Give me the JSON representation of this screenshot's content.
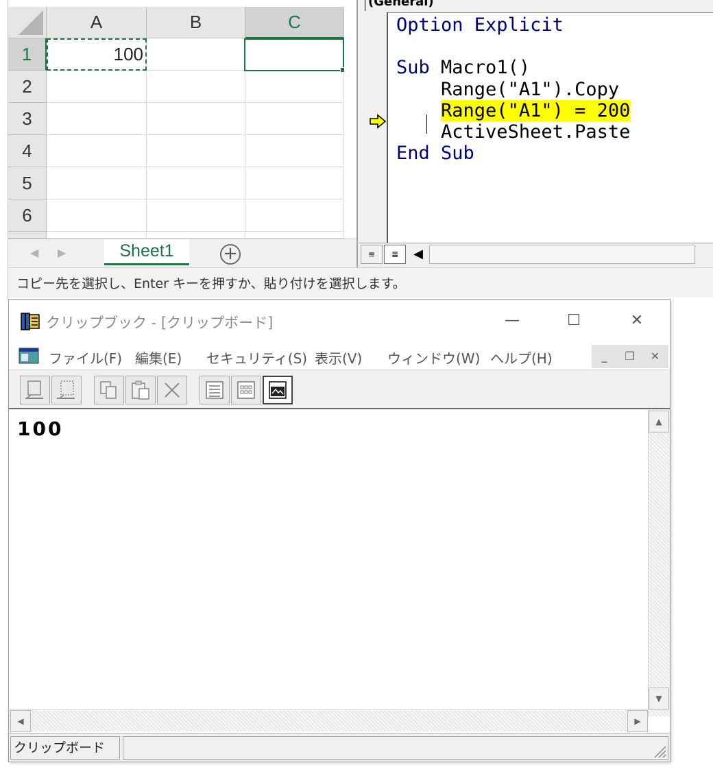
{
  "excel": {
    "columns": [
      "A",
      "B",
      "C"
    ],
    "rows": [
      "1",
      "2",
      "3",
      "4",
      "5",
      "6"
    ],
    "cells": {
      "A1": "100"
    },
    "selected_column": "C",
    "sheet_tab": "Sheet1",
    "add_sheet_symbol": "+",
    "status_message": "コピー先を選択し、Enter キーを押すか、貼り付けを選択します。"
  },
  "vba": {
    "combo_label": "(General)",
    "code": [
      {
        "indent": "",
        "parts": [
          {
            "t": "Option Explicit",
            "kw": true
          }
        ]
      },
      {
        "indent": "",
        "parts": []
      },
      {
        "indent": "",
        "parts": [
          {
            "t": "Sub",
            "kw": true
          },
          {
            "t": " Macro1()",
            "kw": false
          }
        ]
      },
      {
        "indent": "    ",
        "parts": [
          {
            "t": "Range(\"A1\").Copy",
            "kw": false
          }
        ]
      },
      {
        "indent": "    ",
        "parts": [
          {
            "t": "Range(\"A1\") = 200",
            "kw": false,
            "hl": true
          }
        ]
      },
      {
        "indent": "    ",
        "parts": [
          {
            "t": "ActiveSheet.Paste",
            "kw": false
          }
        ]
      },
      {
        "indent": "",
        "parts": [
          {
            "t": "End Sub",
            "kw": true
          }
        ]
      }
    ],
    "highlight_color": "#ffff00",
    "keyword_color": "#00007f"
  },
  "clipbook": {
    "title": "クリップブック - [クリップボード]",
    "window_buttons": {
      "minimize": "—",
      "maximize": "☐",
      "close": "✕"
    },
    "menu": [
      "ファイル(F)",
      "編集(E)",
      "セキュリティ(S)",
      "表示(V)",
      "ウィンドウ(W)",
      "ヘルプ(H)"
    ],
    "mdi_buttons": {
      "minimize": "_",
      "restore": "❐",
      "close": "✕"
    },
    "content": "100",
    "status": "クリップボード"
  }
}
